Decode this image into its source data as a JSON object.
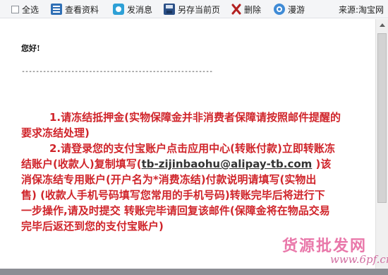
{
  "toolbar": {
    "select_all": "全选",
    "view_profile": "查看资料",
    "send_message": "发消息",
    "save_page": "另存当前页",
    "delete": "删除",
    "roam": "漫游",
    "source": "来源:淘宝网"
  },
  "content": {
    "greeting": "您好!",
    "divider": "------------------------------------------------------",
    "lines": [
      "1.请冻结抵押金(实物保障金并非消费者保障请按照邮件提醒的",
      "要求冻结处理)",
      "2.请登录您的支付宝账户点击应用中心(转账付款)立即转账冻",
      "结账户(收款人)复制填写(",
      "tb-zijinbaohu@alipay-tb.com",
      " )该",
      "消保冻结专用账户(开户名为*消费冻结)付款说明请填写(实物出",
      "售) (收款人手机号码填写您常用的手机号码)转账完毕后将进行下",
      "一步操作,请及时提交 转账完毕请回复该邮件(保障金将在物品交易",
      "完毕后返还到您的支付宝账户)"
    ]
  },
  "watermark": {
    "title": "货源批发网",
    "site": "www.6pf.cn"
  },
  "colors": {
    "body_text": "#d0252b",
    "email": "#333333",
    "toolbar_bg": "#f4f5f7"
  }
}
